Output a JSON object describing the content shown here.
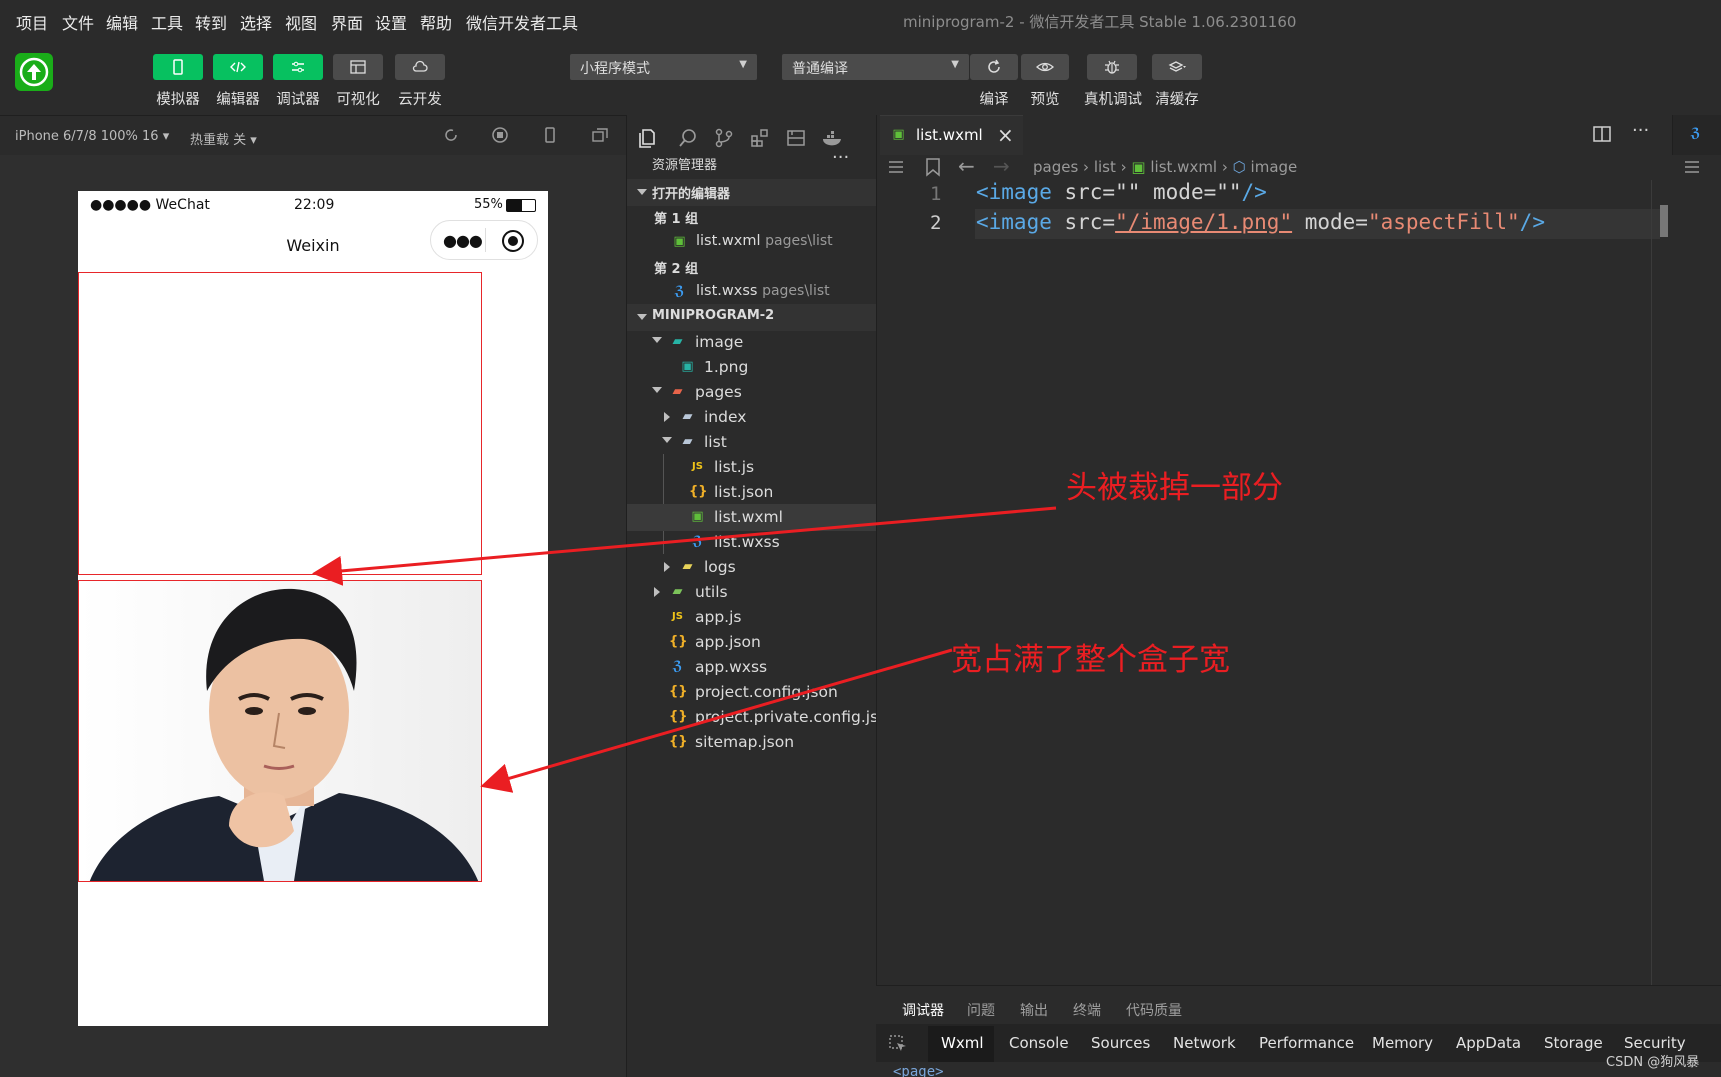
{
  "menu": {
    "items": [
      "项目",
      "文件",
      "编辑",
      "工具",
      "转到",
      "选择",
      "视图",
      "界面",
      "设置",
      "帮助",
      "微信开发者工具"
    ],
    "window_title": "miniprogram-2 - 微信开发者工具 Stable 1.06.2301160"
  },
  "toolbar": {
    "buttons": [
      "模拟器",
      "编辑器",
      "调试器",
      "可视化",
      "云开发"
    ],
    "mode_select": "小程序模式",
    "compile_select": "普通编译",
    "actions": [
      "编译",
      "预览",
      "真机调试",
      "清缓存"
    ]
  },
  "devicebar": {
    "device": "iPhone 6/7/8 100% 16",
    "hot_reload": "热重载 关"
  },
  "phone": {
    "carrier": "●●●●● WeChat",
    "time": "22:09",
    "battery": "55%",
    "battery_level": 0.55,
    "nav_title": "Weixin"
  },
  "explorer": {
    "title": "资源管理器",
    "open_editors": "打开的编辑器",
    "group1": "第 1 组",
    "group1_file": "list.wxml",
    "group1_path": "pages\\list",
    "group2": "第 2 组",
    "group2_file": "list.wxss",
    "group2_path": "pages\\list",
    "project": "MINIPROGRAM-2",
    "tree": {
      "image": "image",
      "png": "1.png",
      "pages": "pages",
      "index": "index",
      "list": "list",
      "listjs": "list.js",
      "listjson": "list.json",
      "listwxml": "list.wxml",
      "listwxss": "list.wxss",
      "logs": "logs",
      "utils": "utils",
      "appjs": "app.js",
      "appjson": "app.json",
      "appwxss": "app.wxss",
      "projcfg": "project.config.json",
      "projpriv": "project.private.config.js...",
      "sitemap": "sitemap.json"
    }
  },
  "editor": {
    "tab": "list.wxml",
    "breadcrumb": [
      "pages",
      "list",
      "list.wxml",
      "image"
    ],
    "lines": [
      "1",
      "2"
    ],
    "line1": {
      "tag": "<image",
      "a1": " src=",
      "v1": "\"\"",
      "a2": " mode=",
      "v2": "\"\"",
      "end": "/>"
    },
    "line2": {
      "tag": "<image",
      "a1": " src=",
      "v1": "\"/image/1.png\"",
      "a2": " mode=",
      "v2": "\"aspectFill\"",
      "end": "/>"
    }
  },
  "bottom": {
    "tabs": [
      "调试器",
      "问题",
      "输出",
      "终端",
      "代码质量"
    ],
    "devtabs": [
      "Wxml",
      "Console",
      "Sources",
      "Network",
      "Performance",
      "Memory",
      "AppData",
      "Storage",
      "Security"
    ],
    "page_node": "<page>"
  },
  "annotations": {
    "a1": "头被裁掉一部分",
    "a2": "宽占满了整个盒子宽"
  },
  "watermark": "CSDN @狗风暴",
  "colors": {
    "accent": "#07c160",
    "annotation": "#ea1e22",
    "tag": "#5aa9e6",
    "string": "#e88a74"
  }
}
